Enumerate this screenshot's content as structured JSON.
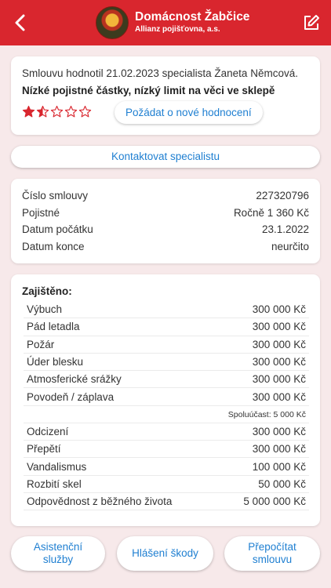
{
  "header": {
    "title": "Domácnost Žabčice",
    "subtitle": "Allianz pojišťovna, a.s.",
    "back_icon": "chevron-left-icon",
    "edit_icon": "edit-icon"
  },
  "rating": {
    "text": "Smlouvu hodnotil 21.02.2023 specialista Žaneta Němcová.",
    "summary": "Nízké pojistné částky, nízký limit na věci ve sklepě",
    "stars_value": 1.5,
    "stars_max": 5,
    "request_button": "Požádat o nové hodnocení"
  },
  "contact_button": "Kontaktovat specialistu",
  "contract": {
    "rows": [
      {
        "label": "Číslo smlouvy",
        "value": "227320796"
      },
      {
        "label": "Pojistné",
        "value": "Ročně 1 360 Kč"
      },
      {
        "label": "Datum počátku",
        "value": "23.1.2022"
      },
      {
        "label": "Datum konce",
        "value": "neurčito"
      }
    ]
  },
  "coverage": {
    "heading": "Zajištěno:",
    "rows_a": [
      {
        "label": "Výbuch",
        "value": "300 000 Kč"
      },
      {
        "label": "Pád letadla",
        "value": "300 000 Kč"
      },
      {
        "label": "Požár",
        "value": "300 000 Kč"
      },
      {
        "label": "Úder blesku",
        "value": "300 000 Kč"
      },
      {
        "label": "Atmosferické srážky",
        "value": "300 000 Kč"
      },
      {
        "label": "Povodeň / záplava",
        "value": "300 000 Kč"
      }
    ],
    "note": "Spoluúčast: 5 000 Kč",
    "rows_b": [
      {
        "label": "Odcizení",
        "value": "300 000 Kč"
      },
      {
        "label": "Přepětí",
        "value": "300 000 Kč"
      },
      {
        "label": "Vandalismus",
        "value": "100 000 Kč"
      },
      {
        "label": "Rozbití skel",
        "value": "50 000 Kč"
      },
      {
        "label": "Odpovědnost z běžného života",
        "value": "5 000 000 Kč"
      }
    ]
  },
  "actions": {
    "assist": "Asistenční\nslužby",
    "claim": "Hlášení škody",
    "recalc": "Přepočítat\nsmlouvu"
  },
  "colors": {
    "brand": "#d9262e",
    "link": "#1f7fd1",
    "background": "#f7e9ea"
  }
}
